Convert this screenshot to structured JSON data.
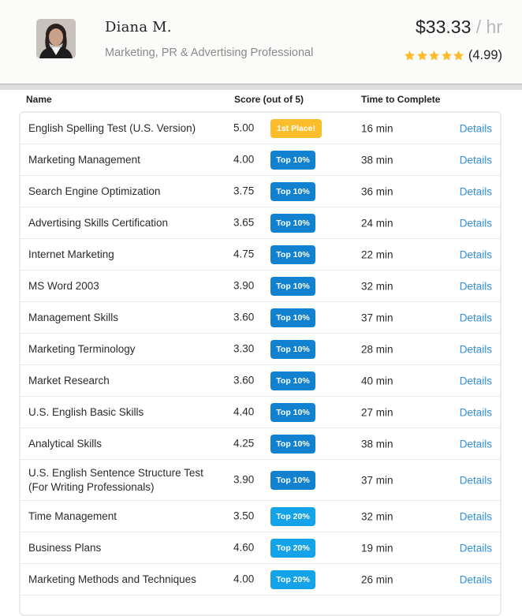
{
  "profile": {
    "name": "Diana M.",
    "title": "Marketing, PR & Advertising Professional",
    "rate": "$33.33",
    "rate_unit": "/ hr",
    "rating_stars": 5,
    "rating_value": "(4.99)",
    "avatar_icon": "user-photo",
    "star_icon": "star-icon",
    "star_color": "#fbbd2c"
  },
  "table": {
    "headers": {
      "name": "Name",
      "score": "Score (out of 5)",
      "time": "Time to Complete"
    },
    "badge_colors": {
      "gold": "#fbbd2c",
      "top10": "#1282d0",
      "top20": "#13a3e8"
    },
    "link_color": "#2f8fd8",
    "rows": [
      {
        "name": "English Spelling Test (U.S. Version)",
        "score": "5.00",
        "badge": "1st Place!",
        "badge_type": "gold",
        "time": "16 min",
        "details": "Details"
      },
      {
        "name": "Marketing Management",
        "score": "4.00",
        "badge": "Top 10%",
        "badge_type": "top10",
        "time": "38 min",
        "details": "Details"
      },
      {
        "name": "Search Engine Optimization",
        "score": "3.75",
        "badge": "Top 10%",
        "badge_type": "top10",
        "time": "36 min",
        "details": "Details"
      },
      {
        "name": "Advertising Skills Certification",
        "score": "3.65",
        "badge": "Top 10%",
        "badge_type": "top10",
        "time": "24 min",
        "details": "Details"
      },
      {
        "name": "Internet Marketing",
        "score": "4.75",
        "badge": "Top 10%",
        "badge_type": "top10",
        "time": "22 min",
        "details": "Details"
      },
      {
        "name": "MS Word 2003",
        "score": "3.90",
        "badge": "Top 10%",
        "badge_type": "top10",
        "time": "32 min",
        "details": "Details"
      },
      {
        "name": "Management Skills",
        "score": "3.60",
        "badge": "Top 10%",
        "badge_type": "top10",
        "time": "37 min",
        "details": "Details"
      },
      {
        "name": "Marketing Terminology",
        "score": "3.30",
        "badge": "Top 10%",
        "badge_type": "top10",
        "time": "28 min",
        "details": "Details"
      },
      {
        "name": "Market Research",
        "score": "3.60",
        "badge": "Top 10%",
        "badge_type": "top10",
        "time": "40 min",
        "details": "Details"
      },
      {
        "name": "U.S. English Basic Skills",
        "score": "4.40",
        "badge": "Top 10%",
        "badge_type": "top10",
        "time": "27 min",
        "details": "Details"
      },
      {
        "name": "Analytical Skills",
        "score": "4.25",
        "badge": "Top 10%",
        "badge_type": "top10",
        "time": "38 min",
        "details": "Details"
      },
      {
        "name": "U.S. English Sentence Structure Test (For Writing Professionals)",
        "score": "3.90",
        "badge": "Top 10%",
        "badge_type": "top10",
        "time": "37 min",
        "details": "Details",
        "tall": true
      },
      {
        "name": "Time Management",
        "score": "3.50",
        "badge": "Top 20%",
        "badge_type": "top20",
        "time": "32 min",
        "details": "Details"
      },
      {
        "name": "Business Plans",
        "score": "4.60",
        "badge": "Top 20%",
        "badge_type": "top20",
        "time": "19 min",
        "details": "Details"
      },
      {
        "name": "Marketing Methods and Techniques",
        "score": "4.00",
        "badge": "Top 20%",
        "badge_type": "top20",
        "time": "26 min",
        "details": "Details"
      }
    ]
  }
}
